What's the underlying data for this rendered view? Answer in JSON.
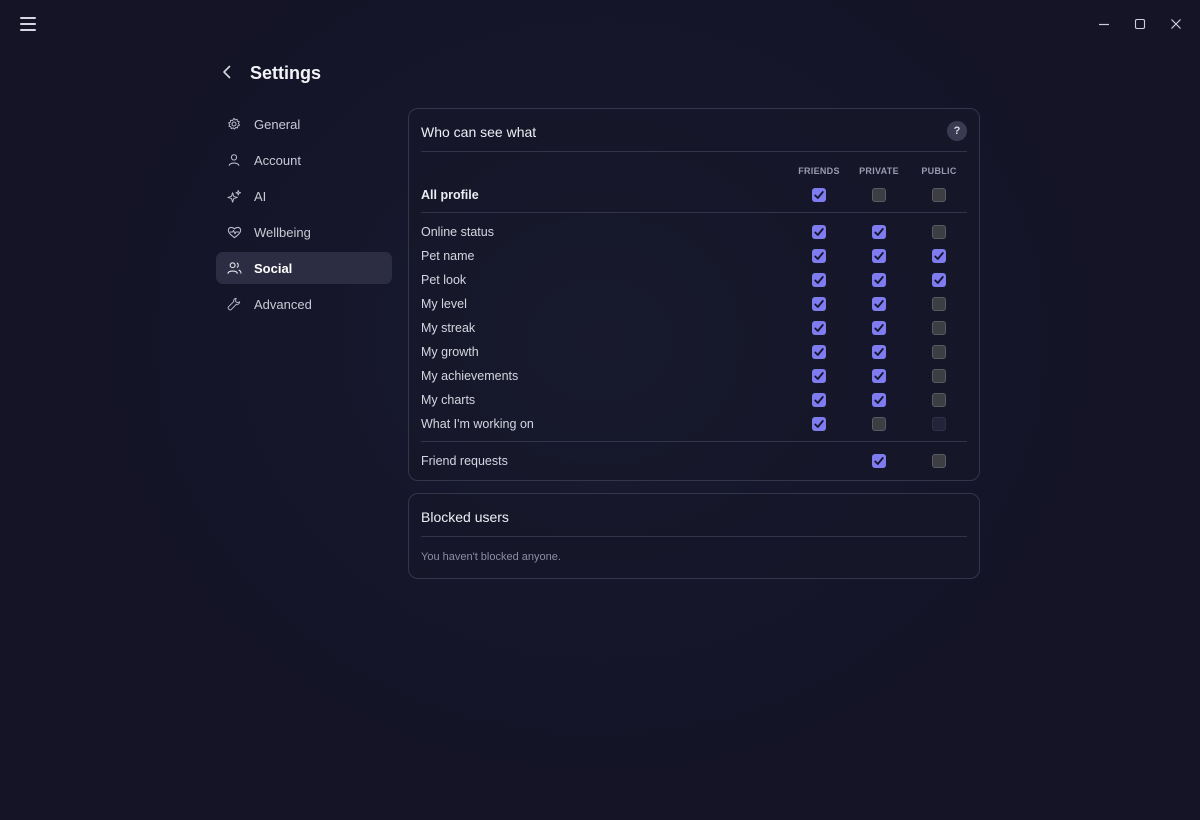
{
  "window": {
    "menu_icon": "hamburger-icon",
    "controls": [
      "minimize-icon",
      "maximize-icon",
      "close-icon"
    ]
  },
  "header": {
    "back_icon": "chevron-left-icon",
    "title": "Settings"
  },
  "sidebar": {
    "items": [
      {
        "label": "General",
        "icon": "gear-icon",
        "active": false
      },
      {
        "label": "Account",
        "icon": "user-icon",
        "active": false
      },
      {
        "label": "AI",
        "icon": "sparkles-icon",
        "active": false
      },
      {
        "label": "Wellbeing",
        "icon": "heart-pulse-icon",
        "active": false
      },
      {
        "label": "Social",
        "icon": "users-icon",
        "active": true
      },
      {
        "label": "Advanced",
        "icon": "wrench-icon",
        "active": false
      }
    ]
  },
  "visibility": {
    "title": "Who can see what",
    "help_label": "?",
    "columns": [
      "FRIENDS",
      "PRIVATE",
      "PUBLIC"
    ],
    "all_profile": {
      "label": "All profile",
      "values": [
        true,
        false,
        false
      ]
    },
    "rows": [
      {
        "label": "Online status",
        "values": [
          true,
          true,
          false
        ]
      },
      {
        "label": "Pet name",
        "values": [
          true,
          true,
          true
        ]
      },
      {
        "label": "Pet look",
        "values": [
          true,
          true,
          true
        ]
      },
      {
        "label": "My level",
        "values": [
          true,
          true,
          false
        ]
      },
      {
        "label": "My streak",
        "values": [
          true,
          true,
          false
        ]
      },
      {
        "label": "My growth",
        "values": [
          true,
          true,
          false
        ]
      },
      {
        "label": "My achievements",
        "values": [
          true,
          true,
          false
        ]
      },
      {
        "label": "My charts",
        "values": [
          true,
          true,
          false
        ]
      },
      {
        "label": "What I'm working on",
        "values": [
          true,
          false,
          "disabled"
        ]
      }
    ],
    "friend_requests": {
      "label": "Friend requests",
      "values": [
        null,
        true,
        false
      ]
    }
  },
  "blocked": {
    "title": "Blocked users",
    "empty_text": "You haven't blocked anyone."
  },
  "colors": {
    "accent": "#7f7cf0",
    "background": "#15162a",
    "card_border": "#34354c"
  }
}
